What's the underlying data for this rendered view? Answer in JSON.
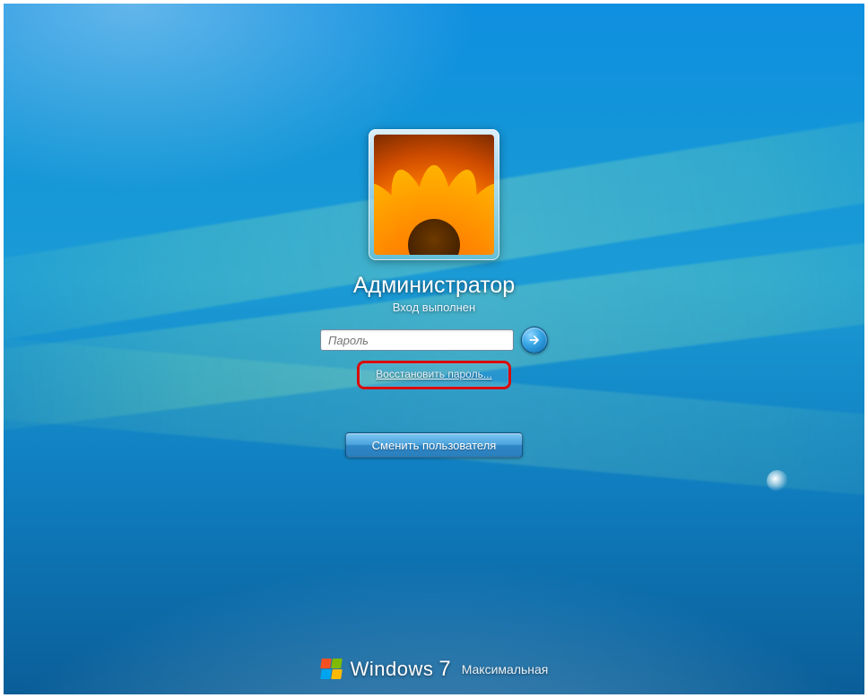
{
  "user": {
    "name": "Администратор",
    "status": "Вход выполнен"
  },
  "password": {
    "placeholder": "Пароль",
    "value": ""
  },
  "links": {
    "reset_password": "Восстановить пароль..."
  },
  "buttons": {
    "switch_user": "Сменить пользователя"
  },
  "branding": {
    "product": "Windows",
    "version": "7",
    "edition": "Максимальная"
  },
  "icons": {
    "submit": "arrow-right-icon",
    "logo": "windows-flag-icon"
  },
  "highlight": {
    "target": "reset-password-link",
    "color": "#d90b0b"
  }
}
